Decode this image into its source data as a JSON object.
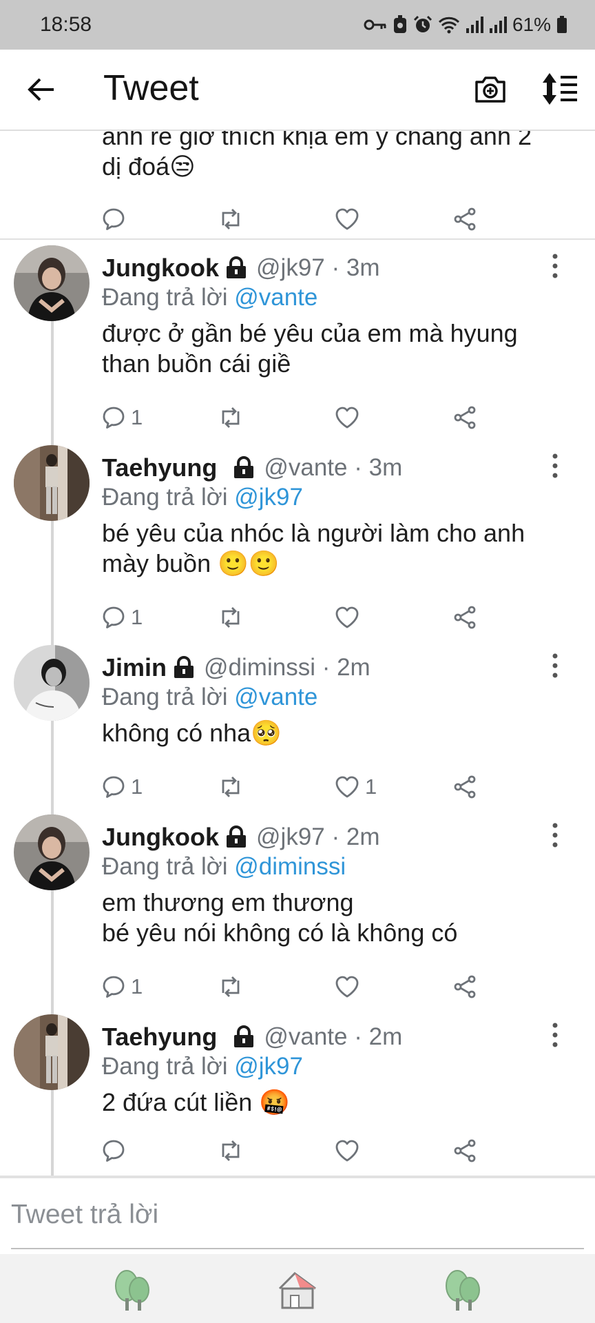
{
  "status_bar": {
    "time": "18:58",
    "battery": "61%"
  },
  "app_bar": {
    "title": "Tweet"
  },
  "partial_tweet": {
    "text": "anh rể giờ thích khịa em y chang anh 2\ndị đoá😒"
  },
  "tweets": [
    {
      "name": "Jungkook",
      "meta": "@jk97 · 3m",
      "reply_prefix": "Đang trả lời ",
      "reply_mention": "@vante",
      "text": "được ở gần bé yêu của em mà hyung\nthan buồn cái giề",
      "reply_count": "1",
      "like_count": ""
    },
    {
      "name": "Taehyung",
      "meta": "@vante · 3m",
      "reply_prefix": "Đang trả lời ",
      "reply_mention": "@jk97",
      "text": "bé yêu của nhóc là người làm cho anh\nmày buồn 🙂🙂",
      "reply_count": "1",
      "like_count": ""
    },
    {
      "name": "Jimin",
      "meta": "@diminssi · 2m",
      "reply_prefix": "Đang trả lời ",
      "reply_mention": "@vante",
      "text": "không có nha🥺",
      "reply_count": "1",
      "like_count": "1"
    },
    {
      "name": "Jungkook",
      "meta": "@jk97 · 2m",
      "reply_prefix": "Đang trả lời ",
      "reply_mention": "@diminssi",
      "text": "em thương em thương\nbé yêu nói không có là không có",
      "reply_count": "1",
      "like_count": ""
    },
    {
      "name": "Taehyung",
      "meta": "@vante · 2m",
      "reply_prefix": "Đang trả lời ",
      "reply_mention": "@jk97",
      "text": "2 đứa cút liền 🤬",
      "reply_count": "",
      "like_count": ""
    }
  ],
  "composer": {
    "placeholder": "Tweet trả lời"
  },
  "icons": {
    "back": "arrow-left-icon",
    "camera": "camera-add-icon",
    "sort": "sort-icon",
    "lock": "lock-icon",
    "more": "more-vertical-icon",
    "reply": "reply-icon",
    "retweet": "retweet-icon",
    "like": "heart-icon",
    "share": "share-icon",
    "nav": [
      "tree-icon",
      "home-icon",
      "tree-icon"
    ]
  },
  "colors": {
    "mention": "#2f95d8",
    "status_bar": "#c8c8c8",
    "muted_text": "#6d7278",
    "nav_bar": "#f2f2f2"
  }
}
